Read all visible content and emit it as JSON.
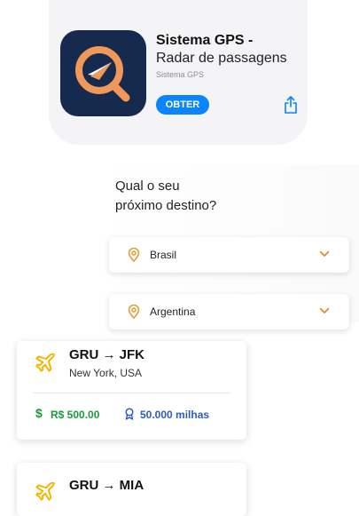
{
  "app": {
    "title": "Sistema GPS -",
    "subtitle": "Radar de passagens",
    "developer": "Sistema GPS",
    "get_label": "OBTER",
    "icon": "radar-magnifier-icon",
    "colors": {
      "icon_bg": "#162a4d",
      "icon_accent": "#f0975a",
      "button": "#0a84ff"
    }
  },
  "destination": {
    "question_line1": "Qual o seu",
    "question_line2": "próximo destino?",
    "options": [
      {
        "label": "Brasil",
        "icon": "location-pin-icon"
      },
      {
        "label": "Argentina",
        "icon": "location-pin-icon"
      }
    ]
  },
  "flights": [
    {
      "route": "GRU → JFK",
      "city": "New York, USA",
      "price": "R$ 500.00",
      "miles": "50.000 milhas"
    },
    {
      "route": "GRU → MIA"
    }
  ],
  "colors": {
    "price": "#1a9b3a",
    "miles": "#2f5bbf",
    "plane": "#f5b400",
    "pin": "#e0a02c",
    "chevron": "#e08a2a"
  }
}
